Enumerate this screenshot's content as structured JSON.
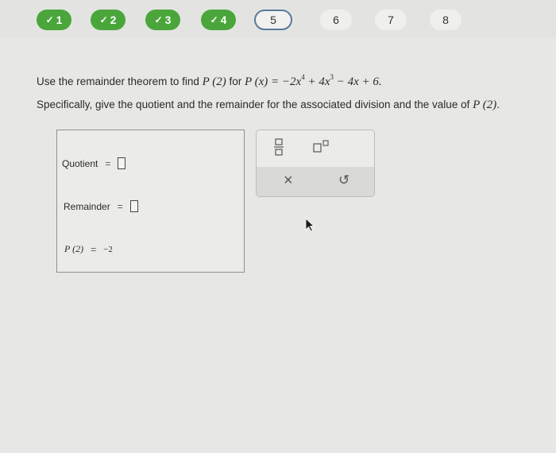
{
  "progress": {
    "steps": [
      {
        "label": "1",
        "state": "done"
      },
      {
        "label": "2",
        "state": "done"
      },
      {
        "label": "3",
        "state": "done"
      },
      {
        "label": "4",
        "state": "done"
      },
      {
        "label": "5",
        "state": "current"
      },
      {
        "label": "6",
        "state": "todo"
      },
      {
        "label": "7",
        "state": "todo"
      },
      {
        "label": "8",
        "state": "todo"
      }
    ],
    "check_glyph": "✓",
    "done_color": "#4aa63a"
  },
  "question": {
    "line1_prefix": "Use the remainder theorem to find ",
    "p_of_2": "P (2)",
    "line1_for": " for ",
    "p_of_x": "P (x)",
    "equals": " = −2x",
    "exp4": "4",
    "plus4x": " + 4x",
    "exp3": "3",
    "rest": " − 4x + 6.",
    "line2_prefix": "Specifically, give the quotient and the remainder for the associated division and the value of ",
    "line2_p": "P (2)",
    "line2_end": "."
  },
  "answer": {
    "quotient_label": "Quotient",
    "remainder_label": "Remainder",
    "equals": "=",
    "p_label": "P (2)",
    "p_value": "−2"
  },
  "tools": {
    "icons": [
      "fraction-icon",
      "exponent-icon",
      "clear-icon",
      "undo-icon"
    ],
    "clear_glyph": "×",
    "undo_glyph": "↺"
  }
}
